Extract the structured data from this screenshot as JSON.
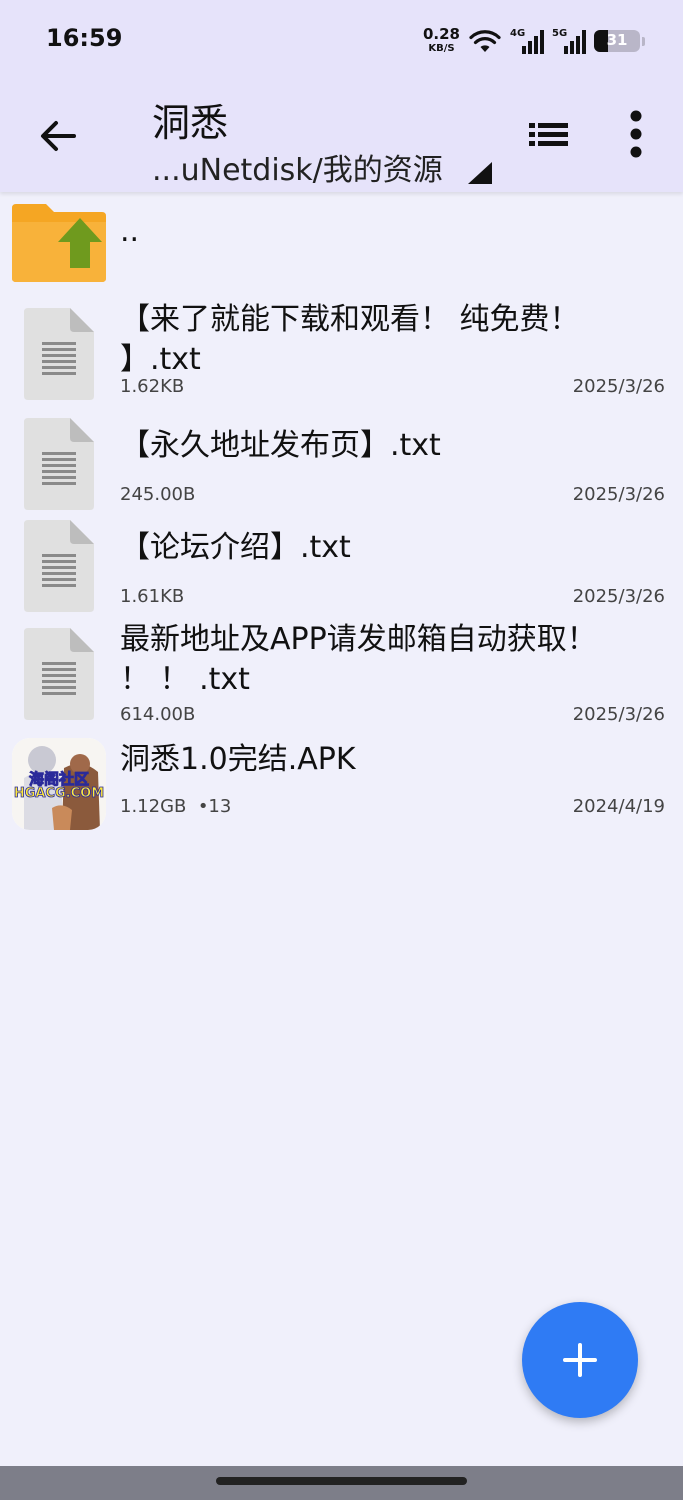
{
  "status_bar": {
    "time": "16:59",
    "net_speed": "0.28",
    "net_unit": "KB/S",
    "signal1_label": "4G",
    "signal2_label": "5G",
    "battery": "31"
  },
  "toolbar": {
    "title": "洞悉",
    "path": "...uNetdisk/我的资源"
  },
  "files": [
    {
      "name": "..",
      "size": "",
      "date": "",
      "icon": "folder-up-icon"
    },
    {
      "name": "【来了就能下载和观看！ 纯免费！ 】.txt",
      "size": "1.62KB",
      "date": "2025/3/26",
      "icon": "text-file-icon"
    },
    {
      "name": "【永久地址发布页】.txt",
      "size": "245.00B",
      "date": "2025/3/26",
      "icon": "text-file-icon"
    },
    {
      "name": "【论坛介绍】.txt",
      "size": "1.61KB",
      "date": "2025/3/26",
      "icon": "text-file-icon"
    },
    {
      "name": "最新地址及APP请发邮箱自动获取！ ！ ！ .txt",
      "size": "614.00B",
      "date": "2025/3/26",
      "icon": "text-file-icon"
    },
    {
      "name": "洞悉1.0完结.APK",
      "size": "1.12GB  •13",
      "date": "2024/4/19",
      "icon": "app-icon"
    }
  ],
  "app_icon_text": {
    "line1": "海阁社区",
    "line2": "HGACG.COM"
  },
  "colors": {
    "header_bg": "#e6e3fa",
    "page_bg": "#f0f0fb",
    "fab": "#2f7bf4",
    "folder": "#f5a623",
    "arrow": "#6f9a1e"
  }
}
